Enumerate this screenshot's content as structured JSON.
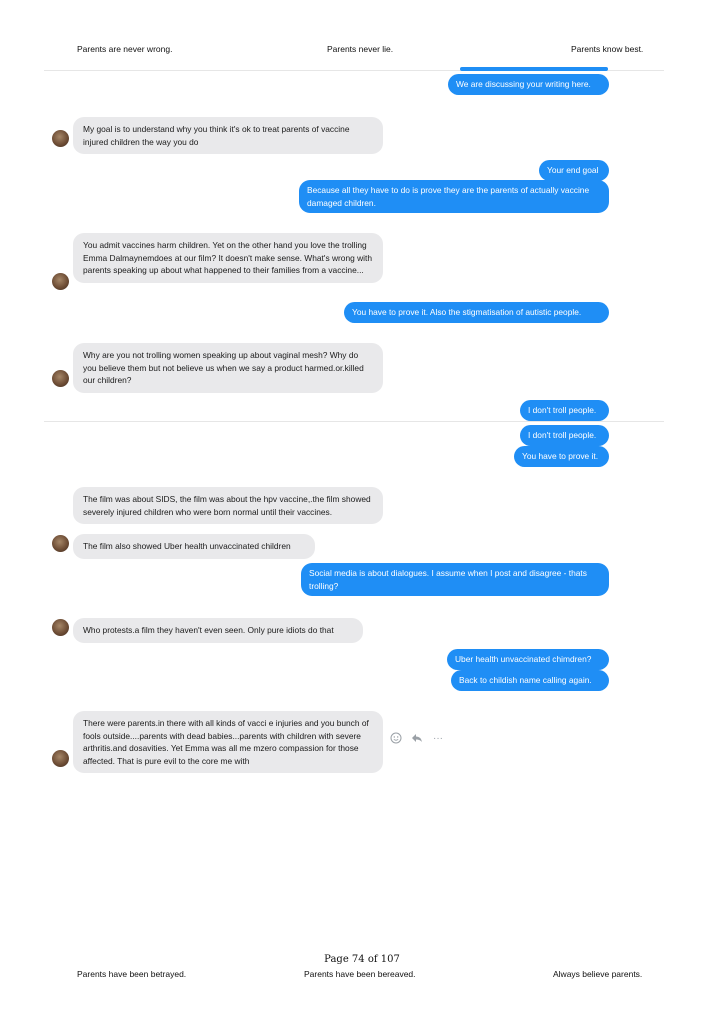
{
  "header": {
    "left": "Parents are never wrong.",
    "center": "Parents never lie.",
    "right": "Parents know best."
  },
  "footer": {
    "page_label": "Page 74 of 107",
    "left": "Parents have been betrayed.",
    "center": "Parents have been bereaved.",
    "right": "Always believe parents."
  },
  "chat": {
    "m01": "We are discussing your writing here.",
    "m02": "My goal is to understand why you think it's ok to treat parents of vaccine injured children the way you do",
    "m03": "Your end goal",
    "m04": "Because all they have to do is prove they are the parents of actually vaccine damaged children.",
    "m05": "You admit vaccines harm children. Yet on the other hand you love the trolling Emma Dalmaynemdoes at our film? It doesn't make sense. What's wrong with parents speaking up about what happened to their families from a vaccine...",
    "m06": "You have to prove it. Also the stigmatisation of autistic people.",
    "m07": "Why are you not trolling women speaking up about vaginal mesh? Why do you believe them but not believe us when we say a product harmed.or.killed our children?",
    "m08": "I don't troll people.",
    "m09": "I don't troll people.",
    "m10": "You have to prove it.",
    "m11": "The film was about SIDS, the film was about the hpv vaccine,.the film showed severely injured children who were born normal until their vaccines.",
    "m12": "The film also showed Uber health unvaccinated children",
    "m13": "Social media is about dialogues. I assume when I post and disagree - thats trolling?",
    "m14": "Who protests.a film they haven't even seen. Only pure idiots do that",
    "m15": "Uber health unvaccinated chimdren?",
    "m16": "Back to childish name calling again.",
    "m17": "There were parents.in there with all kinds of vacci e injuries and you bunch of fools outside....parents with dead babies...parents with children with severe arthritis.and dosavities.  Yet Emma was all me mzero compassion for those affected. That is pure evil to the core me with"
  },
  "actions": {
    "react_icon": "smiley-icon",
    "reply_icon": "reply-icon",
    "more_icon": "more-dots-icon",
    "more_glyph": "···"
  },
  "colors": {
    "outgoing_bubble": "#1f8ef5",
    "incoming_bubble": "#e9e9eb"
  }
}
